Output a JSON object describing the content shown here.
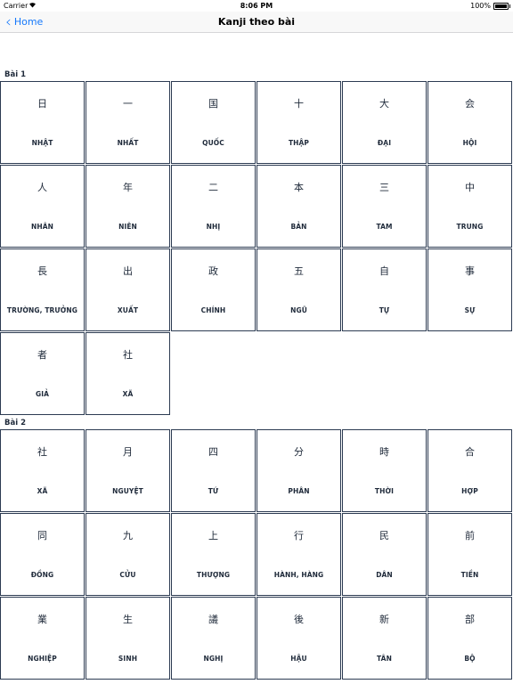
{
  "status_bar": {
    "carrier": "Carrier",
    "time": "8:06 PM",
    "battery": "100%"
  },
  "nav": {
    "back_label": "Home",
    "title": "Kanji theo bài"
  },
  "sections": [
    {
      "title": "Bài 1",
      "items": [
        {
          "kanji": "日",
          "reading": "NHẬT"
        },
        {
          "kanji": "一",
          "reading": "NHẤT"
        },
        {
          "kanji": "国",
          "reading": "QUỐC"
        },
        {
          "kanji": "十",
          "reading": "THẬP"
        },
        {
          "kanji": "大",
          "reading": "ĐẠI"
        },
        {
          "kanji": "会",
          "reading": "HỘI"
        },
        {
          "kanji": "人",
          "reading": "NHÂN"
        },
        {
          "kanji": "年",
          "reading": "NIÊN"
        },
        {
          "kanji": "二",
          "reading": "NHỊ"
        },
        {
          "kanji": "本",
          "reading": "BẢN"
        },
        {
          "kanji": "三",
          "reading": "TAM"
        },
        {
          "kanji": "中",
          "reading": "TRUNG"
        },
        {
          "kanji": "長",
          "reading": "TRƯỜNG, TRƯỞNG"
        },
        {
          "kanji": "出",
          "reading": "XUẤT"
        },
        {
          "kanji": "政",
          "reading": "CHÍNH"
        },
        {
          "kanji": "五",
          "reading": "NGŨ"
        },
        {
          "kanji": "自",
          "reading": "TỰ"
        },
        {
          "kanji": "事",
          "reading": "SỰ"
        },
        {
          "kanji": "者",
          "reading": "GIẢ"
        },
        {
          "kanji": "社",
          "reading": "XÃ"
        }
      ]
    },
    {
      "title": "Bài 2",
      "items": [
        {
          "kanji": "社",
          "reading": "XÃ"
        },
        {
          "kanji": "月",
          "reading": "NGUYỆT"
        },
        {
          "kanji": "四",
          "reading": "TỨ"
        },
        {
          "kanji": "分",
          "reading": "PHÂN"
        },
        {
          "kanji": "時",
          "reading": "THỜI"
        },
        {
          "kanji": "合",
          "reading": "HỢP"
        },
        {
          "kanji": "同",
          "reading": "ĐỒNG"
        },
        {
          "kanji": "九",
          "reading": "CỬU"
        },
        {
          "kanji": "上",
          "reading": "THƯỢNG"
        },
        {
          "kanji": "行",
          "reading": "HÀNH, HÀNG"
        },
        {
          "kanji": "民",
          "reading": "DÂN"
        },
        {
          "kanji": "前",
          "reading": "TIỀN"
        },
        {
          "kanji": "業",
          "reading": "NGHIỆP"
        },
        {
          "kanji": "生",
          "reading": "SINH"
        },
        {
          "kanji": "議",
          "reading": "NGHỊ"
        },
        {
          "kanji": "後",
          "reading": "HẬU"
        },
        {
          "kanji": "新",
          "reading": "TÂN"
        },
        {
          "kanji": "部",
          "reading": "BỘ"
        }
      ]
    }
  ]
}
